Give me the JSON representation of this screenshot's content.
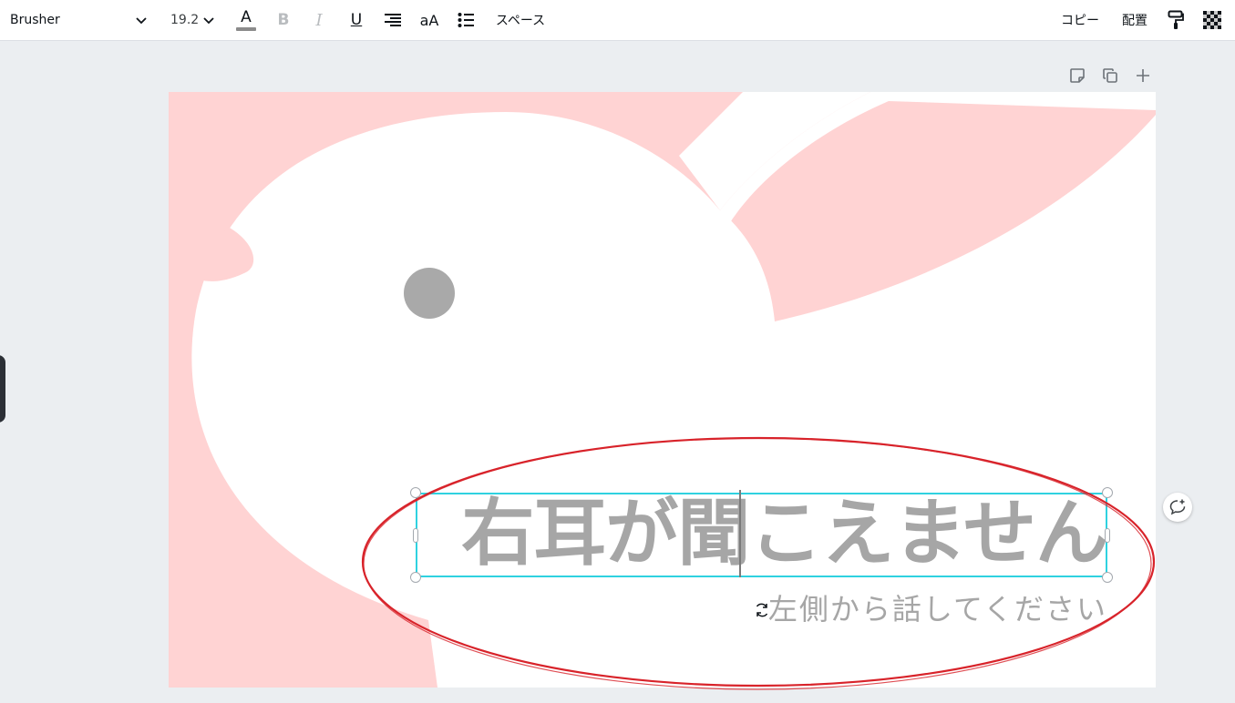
{
  "toolbar": {
    "font_name": "Brusher",
    "font_size": "19.2",
    "text_color_label": "A",
    "bold_label": "B",
    "italic_label": "I",
    "underline_label": "U",
    "case_label": "aA",
    "spacing_label": "スペース",
    "copy_label": "コピー",
    "arrange_label": "配置"
  },
  "design": {
    "headline": "右耳が聞こえません",
    "subtext": "左側から話してください"
  },
  "colors": {
    "background_pink": "#ffd3d3",
    "text_gray": "#a6a6a6",
    "selection": "#2fd2e0",
    "annotation_red": "#d8232a",
    "eye": "#a9a9a9"
  },
  "icons": {
    "font_dropdown": "chevron-down-icon",
    "size_dropdown": "chevron-down-icon",
    "alignment": "align-right-icon",
    "list": "bullet-list-icon",
    "paint_format": "paint-roller-icon",
    "transparency": "checkerboard-icon",
    "page_note": "note-icon",
    "page_duplicate": "duplicate-icon",
    "page_add": "plus-icon",
    "comment": "comment-add-icon",
    "rotate": "rotate-icon"
  }
}
